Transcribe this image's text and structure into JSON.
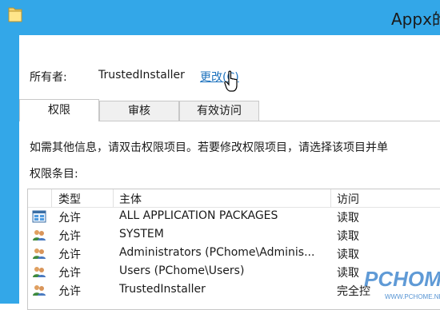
{
  "window": {
    "title": "Appx的"
  },
  "owner": {
    "label": "所有者:",
    "value": "TrustedInstaller",
    "change_link": "更改(C)"
  },
  "tabs": [
    {
      "label": "权限",
      "active": true
    },
    {
      "label": "审核",
      "active": false
    },
    {
      "label": "有效访问",
      "active": false
    }
  ],
  "info_text": "如需其他信息，请双击权限项目。若要修改权限项目，请选择该项目并单",
  "entries_label": "权限条目:",
  "table": {
    "columns": [
      "类型",
      "主体",
      "访问"
    ],
    "rows": [
      {
        "icon": "app-package-icon",
        "type": "允许",
        "principal": "ALL APPLICATION PACKAGES",
        "access": "读取"
      },
      {
        "icon": "users-group-icon",
        "type": "允许",
        "principal": "SYSTEM",
        "access": "读取"
      },
      {
        "icon": "users-group-icon",
        "type": "允许",
        "principal": "Administrators (PChome\\Adminis...",
        "access": "读取"
      },
      {
        "icon": "users-group-icon",
        "type": "允许",
        "principal": "Users (PChome\\Users)",
        "access": "读取"
      },
      {
        "icon": "users-group-icon",
        "type": "允许",
        "principal": "TrustedInstaller",
        "access": "完全控"
      }
    ]
  },
  "watermark": {
    "brand": "PCHOME",
    "url": "WWW.PCHOME.NET"
  },
  "colors": {
    "frame": "#33a7e8",
    "link": "#1e73be",
    "border": "#c8c8c8"
  }
}
